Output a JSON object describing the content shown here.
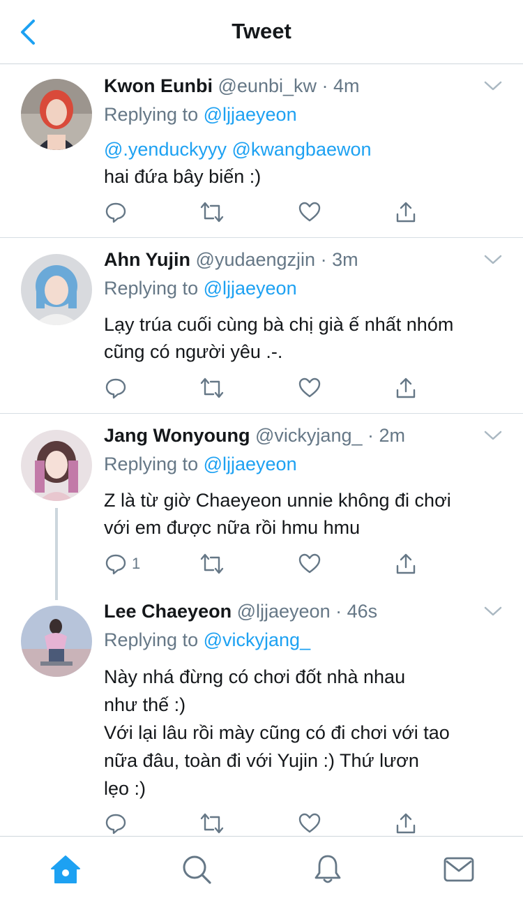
{
  "header": {
    "title": "Tweet"
  },
  "tweets": [
    {
      "name": "Kwon Eunbi",
      "handle": "@eunbi_kw",
      "dot": "·",
      "time": "4m",
      "replying_prefix": "Replying to",
      "replying_to": "@ljjaeyeon",
      "mentions": "@.yenduckyyy @kwangbaewon",
      "lines": [
        "hai đứa bây biến :)"
      ],
      "reply_count": ""
    },
    {
      "name": "Ahn Yujin",
      "handle": "@yudaengzjin",
      "dot": "·",
      "time": "3m",
      "replying_prefix": "Replying to",
      "replying_to": "@ljjaeyeon",
      "lines": [
        "Lạy trúa cuối cùng bà chị già ế nhất nhóm",
        "cũng có người yêu .-."
      ],
      "reply_count": ""
    },
    {
      "name": "Jang Wonyoung",
      "handle": "@vickyjang_",
      "dot": "·",
      "time": "2m",
      "replying_prefix": "Replying to",
      "replying_to": "@ljjaeyeon",
      "lines": [
        "Z là từ giờ Chaeyeon unnie không đi chơi",
        "với em được nữa rồi hmu hmu"
      ],
      "reply_count": "1"
    },
    {
      "name": "Lee Chaeyeon",
      "handle": "@ljjaeyeon",
      "dot": "·",
      "time": "46s",
      "replying_prefix": "Replying to",
      "replying_to": "@vickyjang_",
      "lines": [
        "Này nhá đừng có chơi đốt nhà nhau",
        "như thế :)",
        "Với lại lâu rồi mày cũng có đi chơi với tao",
        "nữa đâu, toàn đi với Yujin :) Thứ lươn",
        "lẹo :)"
      ],
      "reply_count": ""
    }
  ],
  "tabbar": {
    "items": [
      {
        "icon": "home-icon",
        "active": true
      },
      {
        "icon": "search-icon",
        "active": false
      },
      {
        "icon": "bell-icon",
        "active": false
      },
      {
        "icon": "mail-icon",
        "active": false
      }
    ]
  },
  "colors": {
    "accent": "#1da1f2",
    "secondary_text": "#657786",
    "divider": "#d6dde3",
    "primary_text": "#14171a"
  }
}
